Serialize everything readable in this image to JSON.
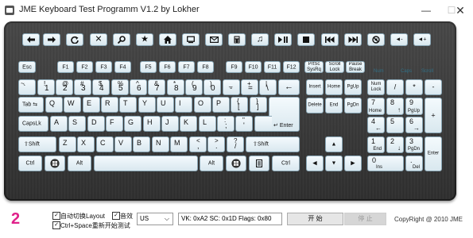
{
  "window": {
    "title": "JME Keyboard Test Programm V1.2 by Lokher",
    "min_label": "—",
    "max_label": "☐",
    "close_label": "✕"
  },
  "media_keys": [
    "back",
    "forward",
    "refresh",
    "stop",
    "search",
    "favorites",
    "home",
    "my-computer",
    "mail",
    "calculator",
    "music",
    "play-pause",
    "stop-media",
    "previous",
    "next",
    "mute",
    "volume-down",
    "volume-up"
  ],
  "function_row": {
    "esc": "Esc",
    "f": [
      "F1",
      "F2",
      "F3",
      "F4",
      "F5",
      "F6",
      "F7",
      "F8",
      "F9",
      "F10",
      "F11",
      "F12"
    ],
    "prtsc": [
      "PrtSc",
      "SysRq"
    ],
    "scroll": [
      "Scroll",
      "Lock"
    ],
    "pause": [
      "Pause",
      "Break"
    ]
  },
  "leds": [
    "Num",
    "Caps",
    "Scroll"
  ],
  "number_row": [
    {
      "top": "~",
      "bottom": "`"
    },
    {
      "top": "!",
      "bottom": "1"
    },
    {
      "top": "@",
      "bottom": "2"
    },
    {
      "top": "#",
      "bottom": "3"
    },
    {
      "top": "$",
      "bottom": "4"
    },
    {
      "top": "%",
      "bottom": "5"
    },
    {
      "top": "^",
      "bottom": "6"
    },
    {
      "top": "&",
      "bottom": "7"
    },
    {
      "top": "*",
      "bottom": "8"
    },
    {
      "top": "(",
      "bottom": "9"
    },
    {
      "top": ")",
      "bottom": "0"
    },
    {
      "top": "_",
      "bottom": "-"
    },
    {
      "top": "+",
      "bottom": "="
    },
    {
      "top": "|",
      "bottom": "\\"
    },
    {
      "top": "",
      "bottom": "←"
    }
  ],
  "qwerty_row": {
    "tab": "Tab",
    "letters": [
      "Q",
      "W",
      "E",
      "R",
      "T",
      "Y",
      "U",
      "I",
      "O",
      "P"
    ],
    "brackets": [
      {
        "top": "{",
        "bottom": "["
      },
      {
        "top": "}",
        "bottom": "]"
      }
    ]
  },
  "home_row": {
    "caps": "CapsLk",
    "letters": [
      "A",
      "S",
      "D",
      "F",
      "G",
      "H",
      "J",
      "K",
      "L"
    ],
    "punct": [
      {
        "top": ":",
        "bottom": ";"
      },
      {
        "top": "\"",
        "bottom": "'"
      }
    ],
    "enter": "Enter"
  },
  "shift_row": {
    "shift": "Shift",
    "letters": [
      "Z",
      "X",
      "C",
      "V",
      "B",
      "N",
      "M"
    ],
    "punct": [
      {
        "top": "<",
        "bottom": ","
      },
      {
        "top": ">",
        "bottom": "."
      },
      {
        "top": "?",
        "bottom": "/"
      }
    ]
  },
  "bottom_row": {
    "ctrl": "Ctrl",
    "alt": "Alt",
    "altgr": "Alt",
    "ctrl_right": "Ctrl"
  },
  "nav_cluster": [
    "Insert",
    "Home",
    "PgUp",
    "Delete",
    "End",
    "PgDn"
  ],
  "numpad": {
    "numlock": [
      "Num",
      "Lock"
    ],
    "divide": "/",
    "multiply": "*",
    "minus": "-",
    "plus": "+",
    "enter": "Enter",
    "keys": [
      {
        "top": "7",
        "bottom": "Home"
      },
      {
        "top": "8",
        "bottom": "↑"
      },
      {
        "top": "9",
        "bottom": "PgUp"
      },
      {
        "top": "4",
        "bottom": "←"
      },
      {
        "top": "5",
        "bottom": ""
      },
      {
        "top": "6",
        "bottom": "→"
      },
      {
        "top": "1",
        "bottom": "End"
      },
      {
        "top": "2",
        "bottom": "↓"
      },
      {
        "top": "3",
        "bottom": "PgDn"
      },
      {
        "top": "0",
        "bottom": "Ins"
      },
      {
        "top": ".",
        "bottom": "Del"
      }
    ]
  },
  "footer": {
    "counter": "2",
    "auto_switch_label": "自动切换Layout",
    "auto_switch_checked": true,
    "sound_label": "音效",
    "sound_checked": true,
    "ctrl_space_label": "Ctrl+Space重新开始测试",
    "ctrl_space_checked": true,
    "layout_value": "US",
    "status": "VK: 0xA2  SC: 0x1D  Flags: 0x80",
    "start_label": "开 始",
    "stop_label": "停 止",
    "copyright": "CopyRight @ 2010 JME"
  }
}
